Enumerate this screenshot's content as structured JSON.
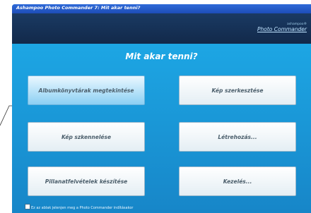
{
  "window": {
    "title": "Ashampoo Photo Commander 7: Mit akar tenni?"
  },
  "header": {
    "brand_small": "ashampoo®",
    "brand": "Photo Commander"
  },
  "main": {
    "heading": "Mit akar tenni?",
    "buttons": [
      {
        "label": "Albumkönyvtárak megtekintése",
        "selected": true
      },
      {
        "label": "Kép szerkesztése",
        "selected": false
      },
      {
        "label": "Kép szkennelése",
        "selected": false
      },
      {
        "label": "Létrehozás...",
        "selected": false
      },
      {
        "label": "Pillanatfelvételek készítése",
        "selected": false
      },
      {
        "label": "Kezelés...",
        "selected": false
      }
    ]
  },
  "footer": {
    "checkbox_label": "Ez az ablak jelenjen meg a Photo Commander indításakor",
    "checkbox_checked": false
  },
  "colors": {
    "background": "#1f9ad8",
    "header": "#12294a",
    "button_selected": "#8cd0f3"
  }
}
